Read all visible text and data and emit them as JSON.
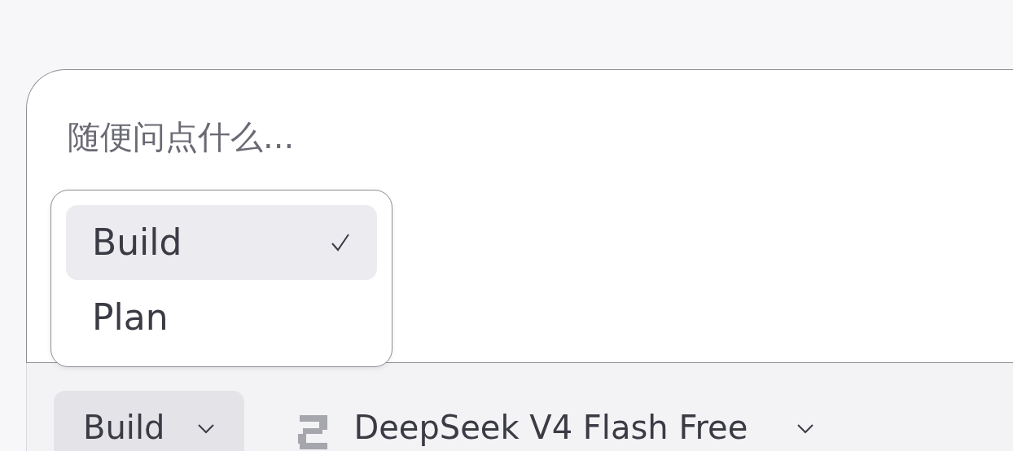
{
  "input": {
    "placeholder": "随便问点什么..."
  },
  "mode_menu": {
    "items": [
      {
        "label": "Build",
        "selected": true
      },
      {
        "label": "Plan",
        "selected": false
      }
    ]
  },
  "toolbar": {
    "mode_button": {
      "label": "Build"
    },
    "model_selector": {
      "label": "DeepSeek V4 Flash Free"
    }
  }
}
